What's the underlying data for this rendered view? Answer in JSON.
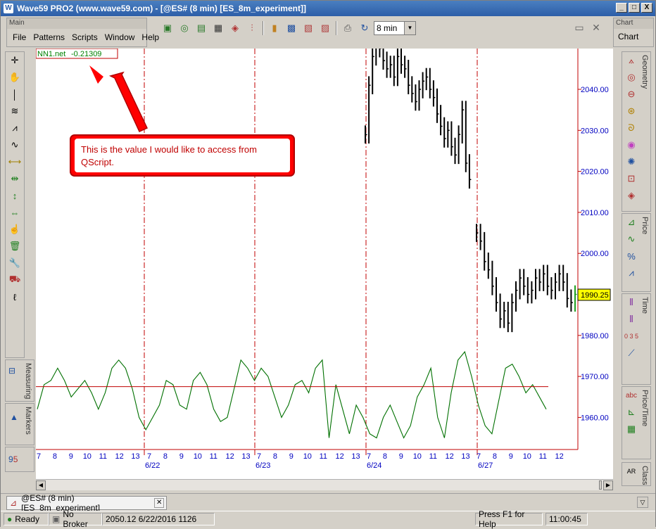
{
  "window": {
    "title": "Wave59 PRO2 (www.wave59.com) - [@ES# (8 min) [ES_8m_experiment]]",
    "buttons": [
      "_",
      "□",
      "X"
    ]
  },
  "main_panel": {
    "title": "Main",
    "menu": [
      "File",
      "Patterns",
      "Scripts",
      "Window",
      "Help"
    ]
  },
  "toolbar": {
    "timeframe": "8 min",
    "restore_symbol": "▭",
    "close_symbol": "✕"
  },
  "chart_panel": {
    "title": "Chart",
    "label": "Chart"
  },
  "side_tabs": {
    "measuring": "Measuring",
    "markers": "Markers",
    "geometry": "Geometry",
    "price": "Price",
    "time": "Time",
    "price_time": "Price/Time",
    "class": "Class"
  },
  "indicator": {
    "name": "NN1.net",
    "value": "-0.21309",
    "color": "#008000"
  },
  "callout": {
    "text_line1": "This is the value I would like to access from",
    "text_line2": "QScript."
  },
  "chart_data": {
    "type": "bar",
    "symbol": "@ES#",
    "interval": "8 min",
    "price_axis": {
      "ticks": [
        "2040.00",
        "2030.00",
        "2020.00",
        "2010.00",
        "2000.00",
        "1990.00",
        "1980.00",
        "1970.00",
        "1960.00"
      ],
      "range": [
        1953,
        2050
      ]
    },
    "last_price": "1990.25",
    "time_axis": {
      "hour_labels": [
        "7",
        "8",
        "9",
        "10",
        "11",
        "12",
        "13",
        "7",
        "8",
        "9",
        "10",
        "11",
        "12",
        "13",
        "7",
        "8",
        "9",
        "10",
        "11",
        "12",
        "13",
        "7",
        "8",
        "9",
        "10",
        "11",
        "12",
        "13",
        "7",
        "8",
        "9",
        "10",
        "11",
        "12"
      ],
      "date_labels": [
        "6/22",
        "6/23",
        "6/24",
        "6/27"
      ]
    },
    "price_series": [
      {
        "session": "6/24",
        "close": [
          2029,
          2041,
          2048,
          2052,
          2050,
          2047,
          2045,
          2046,
          2043,
          2048,
          2046,
          2045,
          2041,
          2039,
          2037,
          2040,
          2042,
          2043,
          2040,
          2038,
          2034,
          2031,
          2028,
          2030,
          2026,
          2024,
          2029,
          2035,
          2022,
          2018
        ]
      },
      {
        "session": "6/27",
        "close": [
          2005,
          2003,
          1998,
          1996,
          1992,
          1988,
          1984,
          1986,
          1983,
          1988,
          1991,
          1994,
          1992,
          1990,
          1991,
          1994,
          1993,
          1995,
          1992,
          1991,
          1993,
          1995,
          1993,
          1989,
          1988,
          1990
        ]
      }
    ],
    "indicator_series": {
      "name": "NN1.net",
      "reference_level": 1967.5,
      "values": [
        1962,
        1968,
        1969,
        1972,
        1969,
        1965,
        1967,
        1969,
        1966,
        1962,
        1966,
        1972,
        1974,
        1972,
        1967,
        1960,
        1957,
        1960,
        1963,
        1969,
        1968,
        1963,
        1962,
        1969,
        1971,
        1968,
        1962,
        1959,
        1960,
        1967,
        1974,
        1972,
        1969,
        1972,
        1970,
        1965,
        1960,
        1963,
        1968,
        1969,
        1966,
        1972,
        1974,
        1955,
        1968,
        1962,
        1956,
        1963,
        1960,
        1956,
        1955,
        1960,
        1963,
        1959,
        1955,
        1958,
        1965,
        1968,
        1972,
        1960,
        1955,
        1966,
        1974,
        1976,
        1970,
        1963,
        1958,
        1956,
        1964,
        1972,
        1973,
        1970,
        1966,
        1968,
        1965,
        1962
      ]
    },
    "session_dividers": [
      "6/22",
      "6/23",
      "6/24",
      "6/27"
    ]
  },
  "doc_tab": {
    "label": "@ES# (8 min) [ES_8m_experiment]"
  },
  "status": {
    "ready": "Ready",
    "broker": "No Broker",
    "info": "2050.12  6/22/2016  1126",
    "help": "Press F1 for Help",
    "time": "11:00:45"
  }
}
